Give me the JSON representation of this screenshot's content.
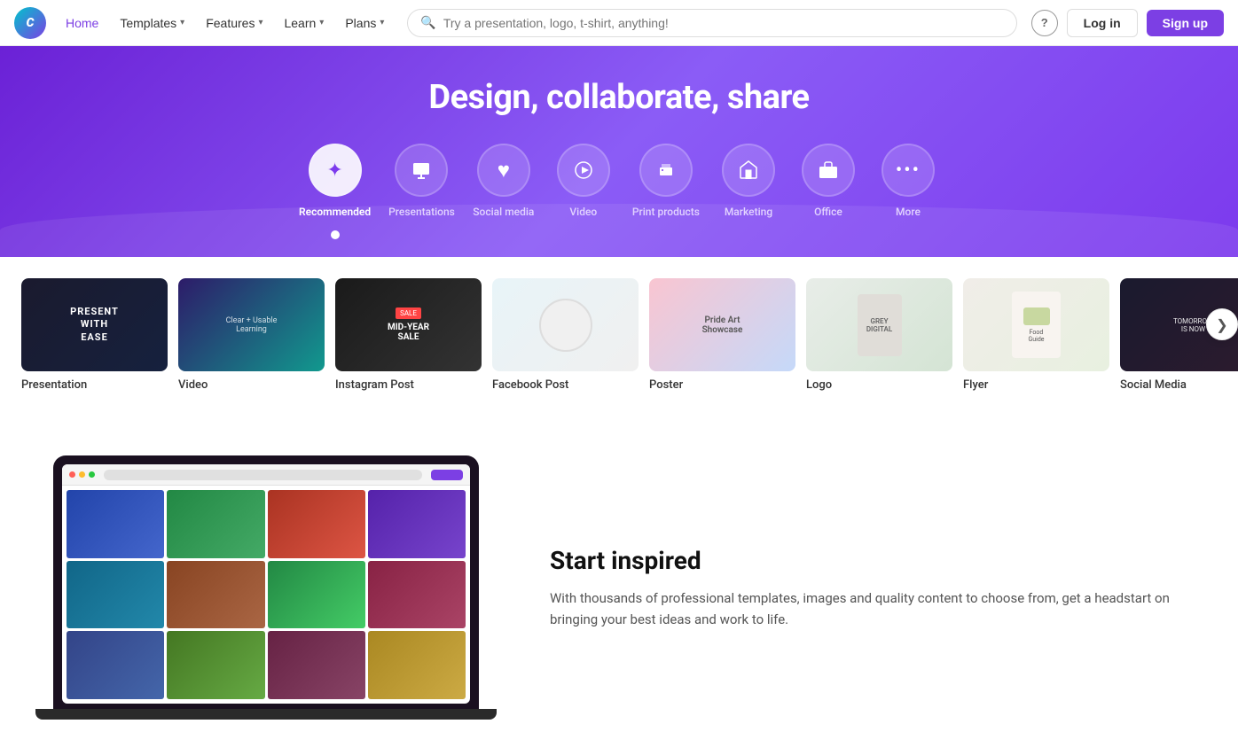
{
  "brand": {
    "name": "Canva",
    "logo_letter": "C"
  },
  "navbar": {
    "home_label": "Home",
    "templates_label": "Templates",
    "features_label": "Features",
    "learn_label": "Learn",
    "plans_label": "Plans",
    "search_placeholder": "Try a presentation, logo, t-shirt, anything!",
    "help_label": "?",
    "login_label": "Log in",
    "signup_label": "Sign up"
  },
  "hero": {
    "title": "Design, collaborate, share",
    "categories": [
      {
        "id": "recommended",
        "label": "Recommended",
        "icon": "✦",
        "active": true
      },
      {
        "id": "presentations",
        "label": "Presentations",
        "icon": "⬛"
      },
      {
        "id": "social-media",
        "label": "Social media",
        "icon": "♥"
      },
      {
        "id": "video",
        "label": "Video",
        "icon": "▶"
      },
      {
        "id": "print-products",
        "label": "Print products",
        "icon": "🖨"
      },
      {
        "id": "marketing",
        "label": "Marketing",
        "icon": "📣"
      },
      {
        "id": "office",
        "label": "Office",
        "icon": "💼"
      },
      {
        "id": "more",
        "label": "More",
        "icon": "•••"
      }
    ]
  },
  "templates": {
    "items": [
      {
        "label": "Presentation",
        "type": "presentation"
      },
      {
        "label": "Video",
        "type": "video"
      },
      {
        "label": "Instagram Post",
        "type": "instagram"
      },
      {
        "label": "Facebook Post",
        "type": "facebook"
      },
      {
        "label": "Poster",
        "type": "poster"
      },
      {
        "label": "Logo",
        "type": "logo"
      },
      {
        "label": "Flyer",
        "type": "flyer"
      },
      {
        "label": "Social Media",
        "type": "social"
      }
    ],
    "scroll_arrow": "❯"
  },
  "inspired": {
    "title": "Start inspired",
    "description": "With thousands of professional templates, images and quality content to choose from, get a headstart on bringing your best ideas and work to life."
  }
}
